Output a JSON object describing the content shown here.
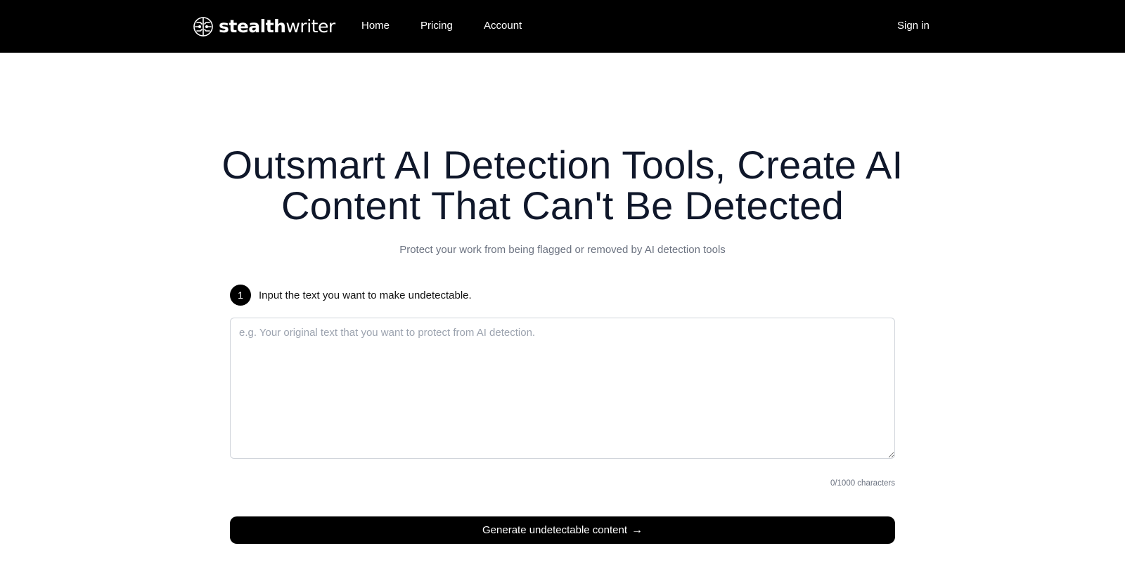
{
  "header": {
    "brand": {
      "name_bold": "stealth",
      "name_light": "writer",
      "icon": "brain-circuit-icon"
    },
    "nav": [
      {
        "label": "Home"
      },
      {
        "label": "Pricing"
      },
      {
        "label": "Account"
      }
    ],
    "sign_in_label": "Sign in"
  },
  "hero": {
    "title": "Outsmart AI Detection Tools, Create AI Content That Can't Be Detected",
    "subtitle": "Protect your work from being flagged or removed by AI detection tools"
  },
  "step": {
    "number": "1",
    "label": "Input the text you want to make undetectable."
  },
  "input": {
    "value": "",
    "placeholder": "e.g. Your original text that you want to protect from AI detection."
  },
  "char_counter": "0/1000 characters",
  "generate_button": {
    "label": "Generate undetectable content",
    "arrow": "→"
  },
  "colors": {
    "header_bg": "#000000",
    "title_color": "#0f172a",
    "muted_text": "#6b7280",
    "button_bg": "#000000"
  }
}
